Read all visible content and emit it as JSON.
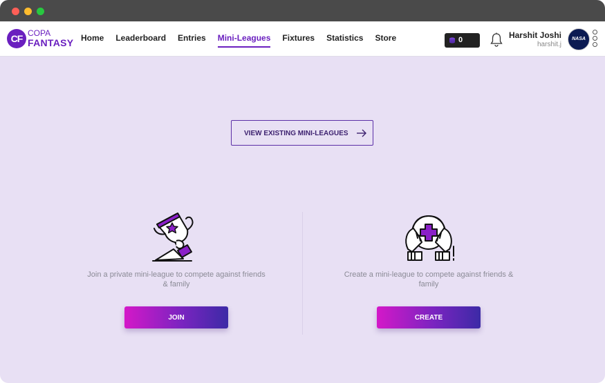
{
  "window": {
    "controls": [
      "close",
      "minimize",
      "zoom"
    ]
  },
  "brand": {
    "mark": "CF",
    "line1": "COPA",
    "line2": "FANTASY"
  },
  "nav": {
    "items": [
      {
        "label": "Home",
        "active": false
      },
      {
        "label": "Leaderboard",
        "active": false
      },
      {
        "label": "Entries",
        "active": false
      },
      {
        "label": "Mini-Leagues",
        "active": true
      },
      {
        "label": "Fixtures",
        "active": false
      },
      {
        "label": "Statistics",
        "active": false
      },
      {
        "label": "Store",
        "active": false
      }
    ]
  },
  "header": {
    "coins": "0",
    "user_name": "Harshit Joshi",
    "user_handle": "harshit.j",
    "avatar_text": "NASA"
  },
  "main": {
    "view_existing_label": "VIEW EXISTING MINI-LEAGUES",
    "join": {
      "description": "Join a private mini-league to compete against friends & family",
      "button_label": "JOIN"
    },
    "create": {
      "description": "Create a mini-league to compete against friends & family",
      "button_label": "CREATE"
    }
  },
  "colors": {
    "accent": "#6a1fbf",
    "background": "#e8e0f4",
    "button_gradient_start": "#d418c8",
    "button_gradient_end": "#3c2aa6"
  },
  "icons": [
    "coins-icon",
    "bell-icon",
    "arrow-right-icon",
    "trophy-icon",
    "hands-ball-icon",
    "more-vertical-icon"
  ]
}
